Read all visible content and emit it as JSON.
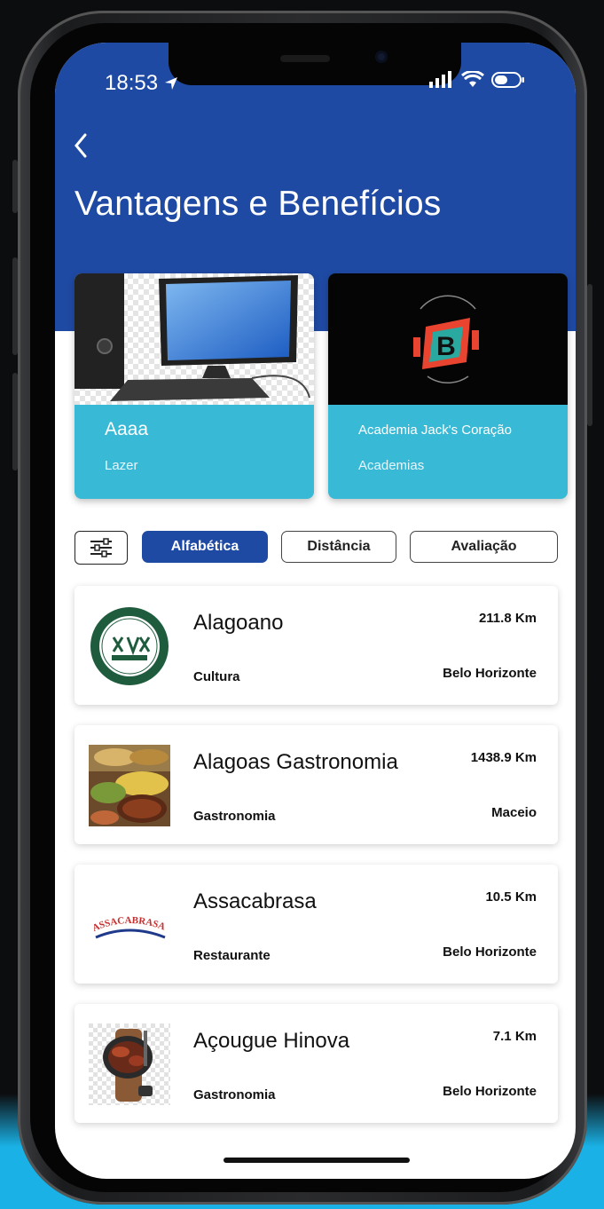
{
  "status_bar": {
    "time": "18:53"
  },
  "header": {
    "title": "Vantagens e Benefícios",
    "back_icon": "chevron-left-icon",
    "color": "#1f4aa4"
  },
  "featured": [
    {
      "title": "Aaaa",
      "category": "Lazer",
      "image": "desktop-computer"
    },
    {
      "title": "Academia Jack's Coração",
      "category": "Academias",
      "image": "battle-fit-logo"
    }
  ],
  "filters": {
    "icon": "sliders-icon",
    "options": [
      {
        "label": "Alfabética",
        "active": true
      },
      {
        "label": "Distância",
        "active": false
      },
      {
        "label": "Avaliação",
        "active": false
      }
    ]
  },
  "items": [
    {
      "name": "Alagoano",
      "category": "Cultura",
      "distance": "211.8 Km",
      "city": "Belo Horizonte",
      "thumb": "nova-acropole-logo"
    },
    {
      "name": "Alagoas Gastronomia",
      "category": "Gastronomia",
      "distance": "1438.9 Km",
      "city": "Maceio",
      "thumb": "food-buffet-photo"
    },
    {
      "name": "Assacabrasa",
      "category": "Restaurante",
      "distance": "10.5 Km",
      "city": "Belo Horizonte",
      "thumb": "assacabrasa-logo",
      "thumb_text": "ASSACABRASA"
    },
    {
      "name": "Açougue Hinova",
      "category": "Gastronomia",
      "distance": "7.1 Km",
      "city": "Belo Horizonte",
      "thumb": "steak-pan-photo"
    }
  ],
  "colors": {
    "primary": "#1f4aa4",
    "card": "#38b9d6",
    "accent_bg": "#1ab2e6"
  }
}
